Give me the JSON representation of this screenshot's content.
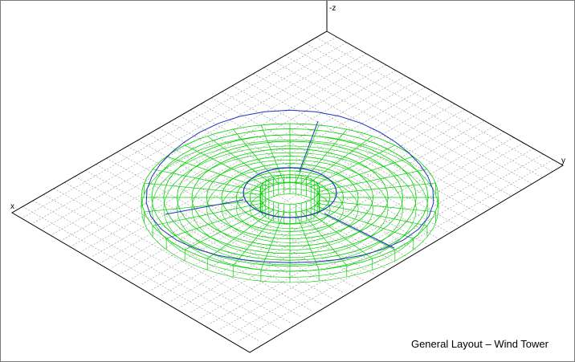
{
  "viewport": {
    "caption": "General Layout – Wind Tower"
  },
  "axes": {
    "z_label": "-z",
    "y_label": "y",
    "x_label": "x"
  },
  "colors": {
    "grid": "#9a9a9a",
    "frame": "#000000",
    "mesh": "#00d000",
    "outline": "#2233bb"
  }
}
